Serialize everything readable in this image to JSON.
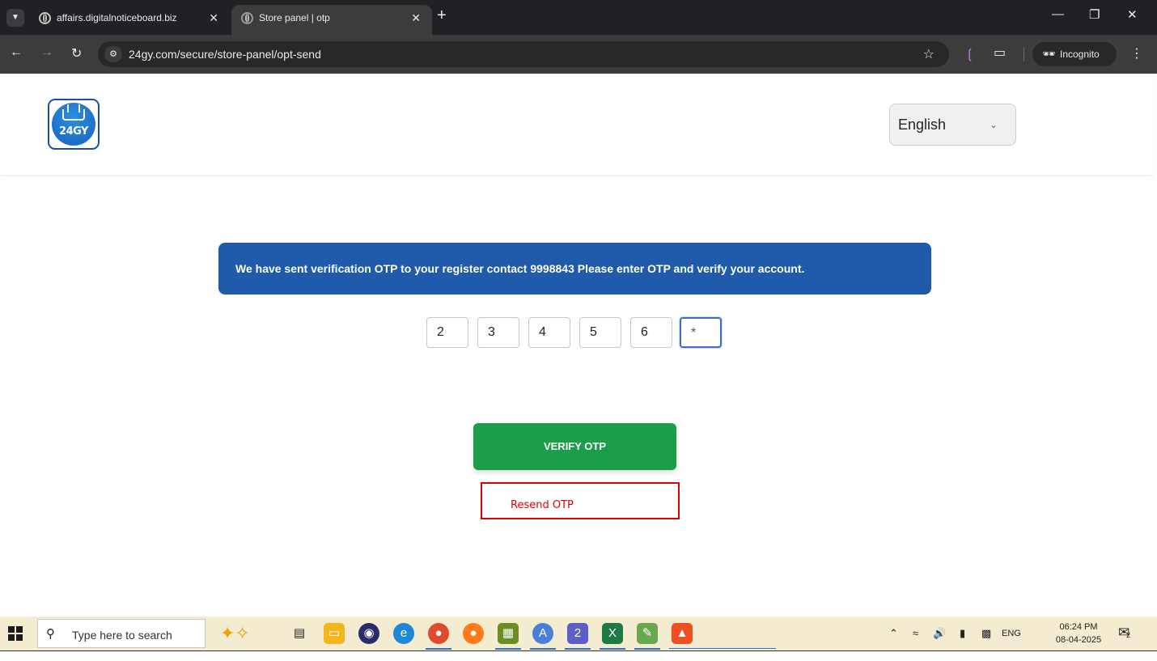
{
  "browser": {
    "tabs": [
      {
        "title": "affairs.digitalnoticeboard.biz",
        "active": false
      },
      {
        "title": "Store panel | otp",
        "active": true
      }
    ],
    "url": "24gy.com/secure/store-panel/opt-send",
    "incognito_label": "Incognito"
  },
  "header": {
    "logo_text": "24GY",
    "language": {
      "selected": "English"
    }
  },
  "main": {
    "alert_text": "We have sent verification OTP to your register contact 9998843 Please enter OTP and verify your account.",
    "otp_digits": [
      "2",
      "3",
      "4",
      "5",
      "6",
      "*"
    ],
    "verify_label": "VERIFY OTP",
    "resend_label": "Resend OTP"
  },
  "taskbar": {
    "search_placeholder": "Type here to search",
    "language": "ENG",
    "time": "06:24 PM",
    "date": "08-04-2025",
    "teams_badge": "2",
    "notification_badge": "2"
  },
  "colors": {
    "alert_bg": "#1f5aab",
    "verify_bg": "#1c9d4a",
    "resend_highlight": "#e00000"
  }
}
